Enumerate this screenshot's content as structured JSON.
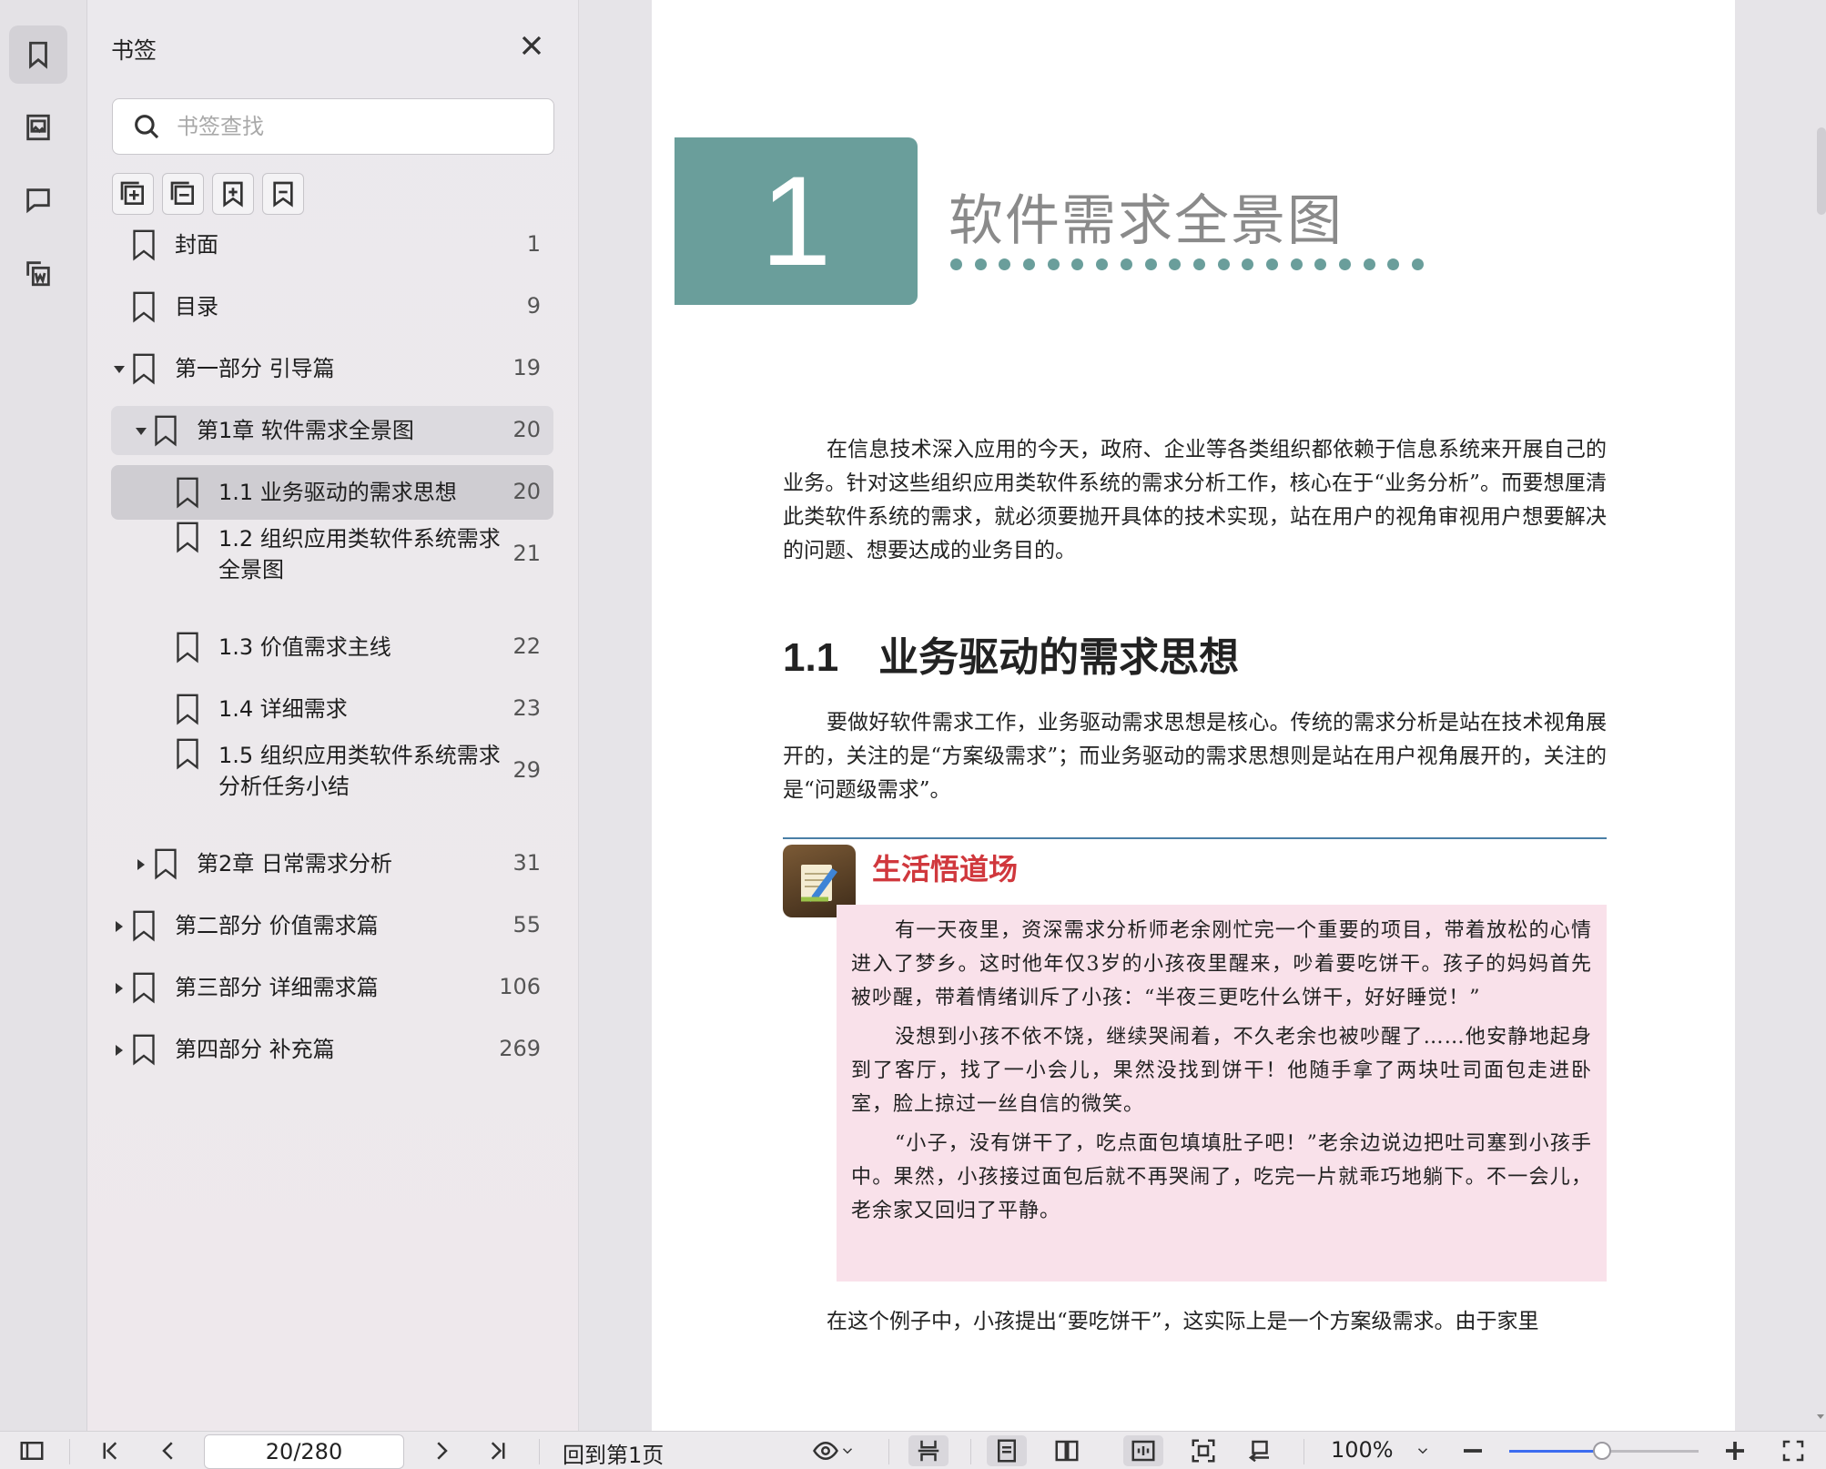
{
  "sidebar": {
    "title": "书签",
    "search_placeholder": "书签查找",
    "items": [
      {
        "label": "封面",
        "page": "1",
        "level": 0,
        "caret": "none",
        "state": ""
      },
      {
        "label": "目录",
        "page": "9",
        "level": 0,
        "caret": "none",
        "state": ""
      },
      {
        "label": "第一部分 引导篇",
        "page": "19",
        "level": 0,
        "caret": "down",
        "state": ""
      },
      {
        "label": "第1章 软件需求全景图",
        "page": "20",
        "level": 1,
        "caret": "down",
        "state": "sel-parent"
      },
      {
        "label": "1.1 业务驱动的需求思想",
        "page": "20",
        "level": 2,
        "caret": "none",
        "state": "sel"
      },
      {
        "label": "1.2 组织应用类软件系统需求\n全景图",
        "page": "21",
        "level": 2,
        "caret": "none",
        "state": ""
      },
      {
        "label": "1.3 价值需求主线",
        "page": "22",
        "level": 2,
        "caret": "none",
        "state": ""
      },
      {
        "label": "1.4 详细需求",
        "page": "23",
        "level": 2,
        "caret": "none",
        "state": ""
      },
      {
        "label": "1.5 组织应用类软件系统需求\n分析任务小结",
        "page": "29",
        "level": 2,
        "caret": "none",
        "state": ""
      },
      {
        "label": "第2章 日常需求分析",
        "page": "31",
        "level": 1,
        "caret": "right",
        "state": ""
      },
      {
        "label": "第二部分 价值需求篇",
        "page": "55",
        "level": 0,
        "caret": "right",
        "state": ""
      },
      {
        "label": "第三部分 详细需求篇",
        "page": "106",
        "level": 0,
        "caret": "right",
        "state": ""
      },
      {
        "label": "第四部分 补充篇",
        "page": "269",
        "level": 0,
        "caret": "right",
        "state": ""
      }
    ]
  },
  "document": {
    "chapter_number": "1",
    "chapter_title": "软件需求全景图",
    "intro": "在信息技术深入应用的今天，政府、企业等各类组织都依赖于信息系统来开展自己的业务。针对这些组织应用类软件系统的需求分析工作，核心在于“业务分析”。而要想厘清此类软件系统的需求，就必须要抛开具体的技术实现，站在用户的视角审视用户想要解决的问题、想要达成的业务目的。",
    "section_heading": "1.1　业务驱动的需求思想",
    "section_para": "要做好软件需求工作，业务驱动需求思想是核心。传统的需求分析是站在技术视角展开的，关注的是“方案级需求”；而业务驱动的需求思想则是站在用户视角展开的，关注的是“问题级需求”。",
    "box_title": "生活悟道场",
    "story": [
      "有一天夜里，资深需求分析师老余刚忙完一个重要的项目，带着放松的心情进入了梦乡。这时他年仅3岁的小孩夜里醒来，吵着要吃饼干。孩子的妈妈首先被吵醒，带着情绪训斥了小孩：“半夜三更吃什么饼干，好好睡觉！”",
      "没想到小孩不依不饶，继续哭闹着，不久老余也被吵醒了……他安静地起身到了客厅，找了一小会儿，果然没找到饼干！他随手拿了两块吐司面包走进卧室，脸上掠过一丝自信的微笑。",
      "“小子，没有饼干了，吃点面包填填肚子吧！”老余边说边把吐司塞到小孩手中。果然，小孩接过面包后就不再哭闹了，吃完一片就乖巧地躺下。不一会儿，老余家又回归了平静。"
    ],
    "bottom_para": "在这个例子中，小孩提出“要吃饼干”，这实际上是一个方案级需求。由于家里"
  },
  "statusbar": {
    "page_value": "20/280",
    "goto_first": "回到第1页",
    "zoom": "100%",
    "zoom_slider_fraction": 0.49
  },
  "colors": {
    "accent_teal": "#6a9e9b",
    "box_title_red": "#d0383d",
    "story_bg": "#f9e1ea",
    "slider_blue": "#3d6cf0"
  }
}
